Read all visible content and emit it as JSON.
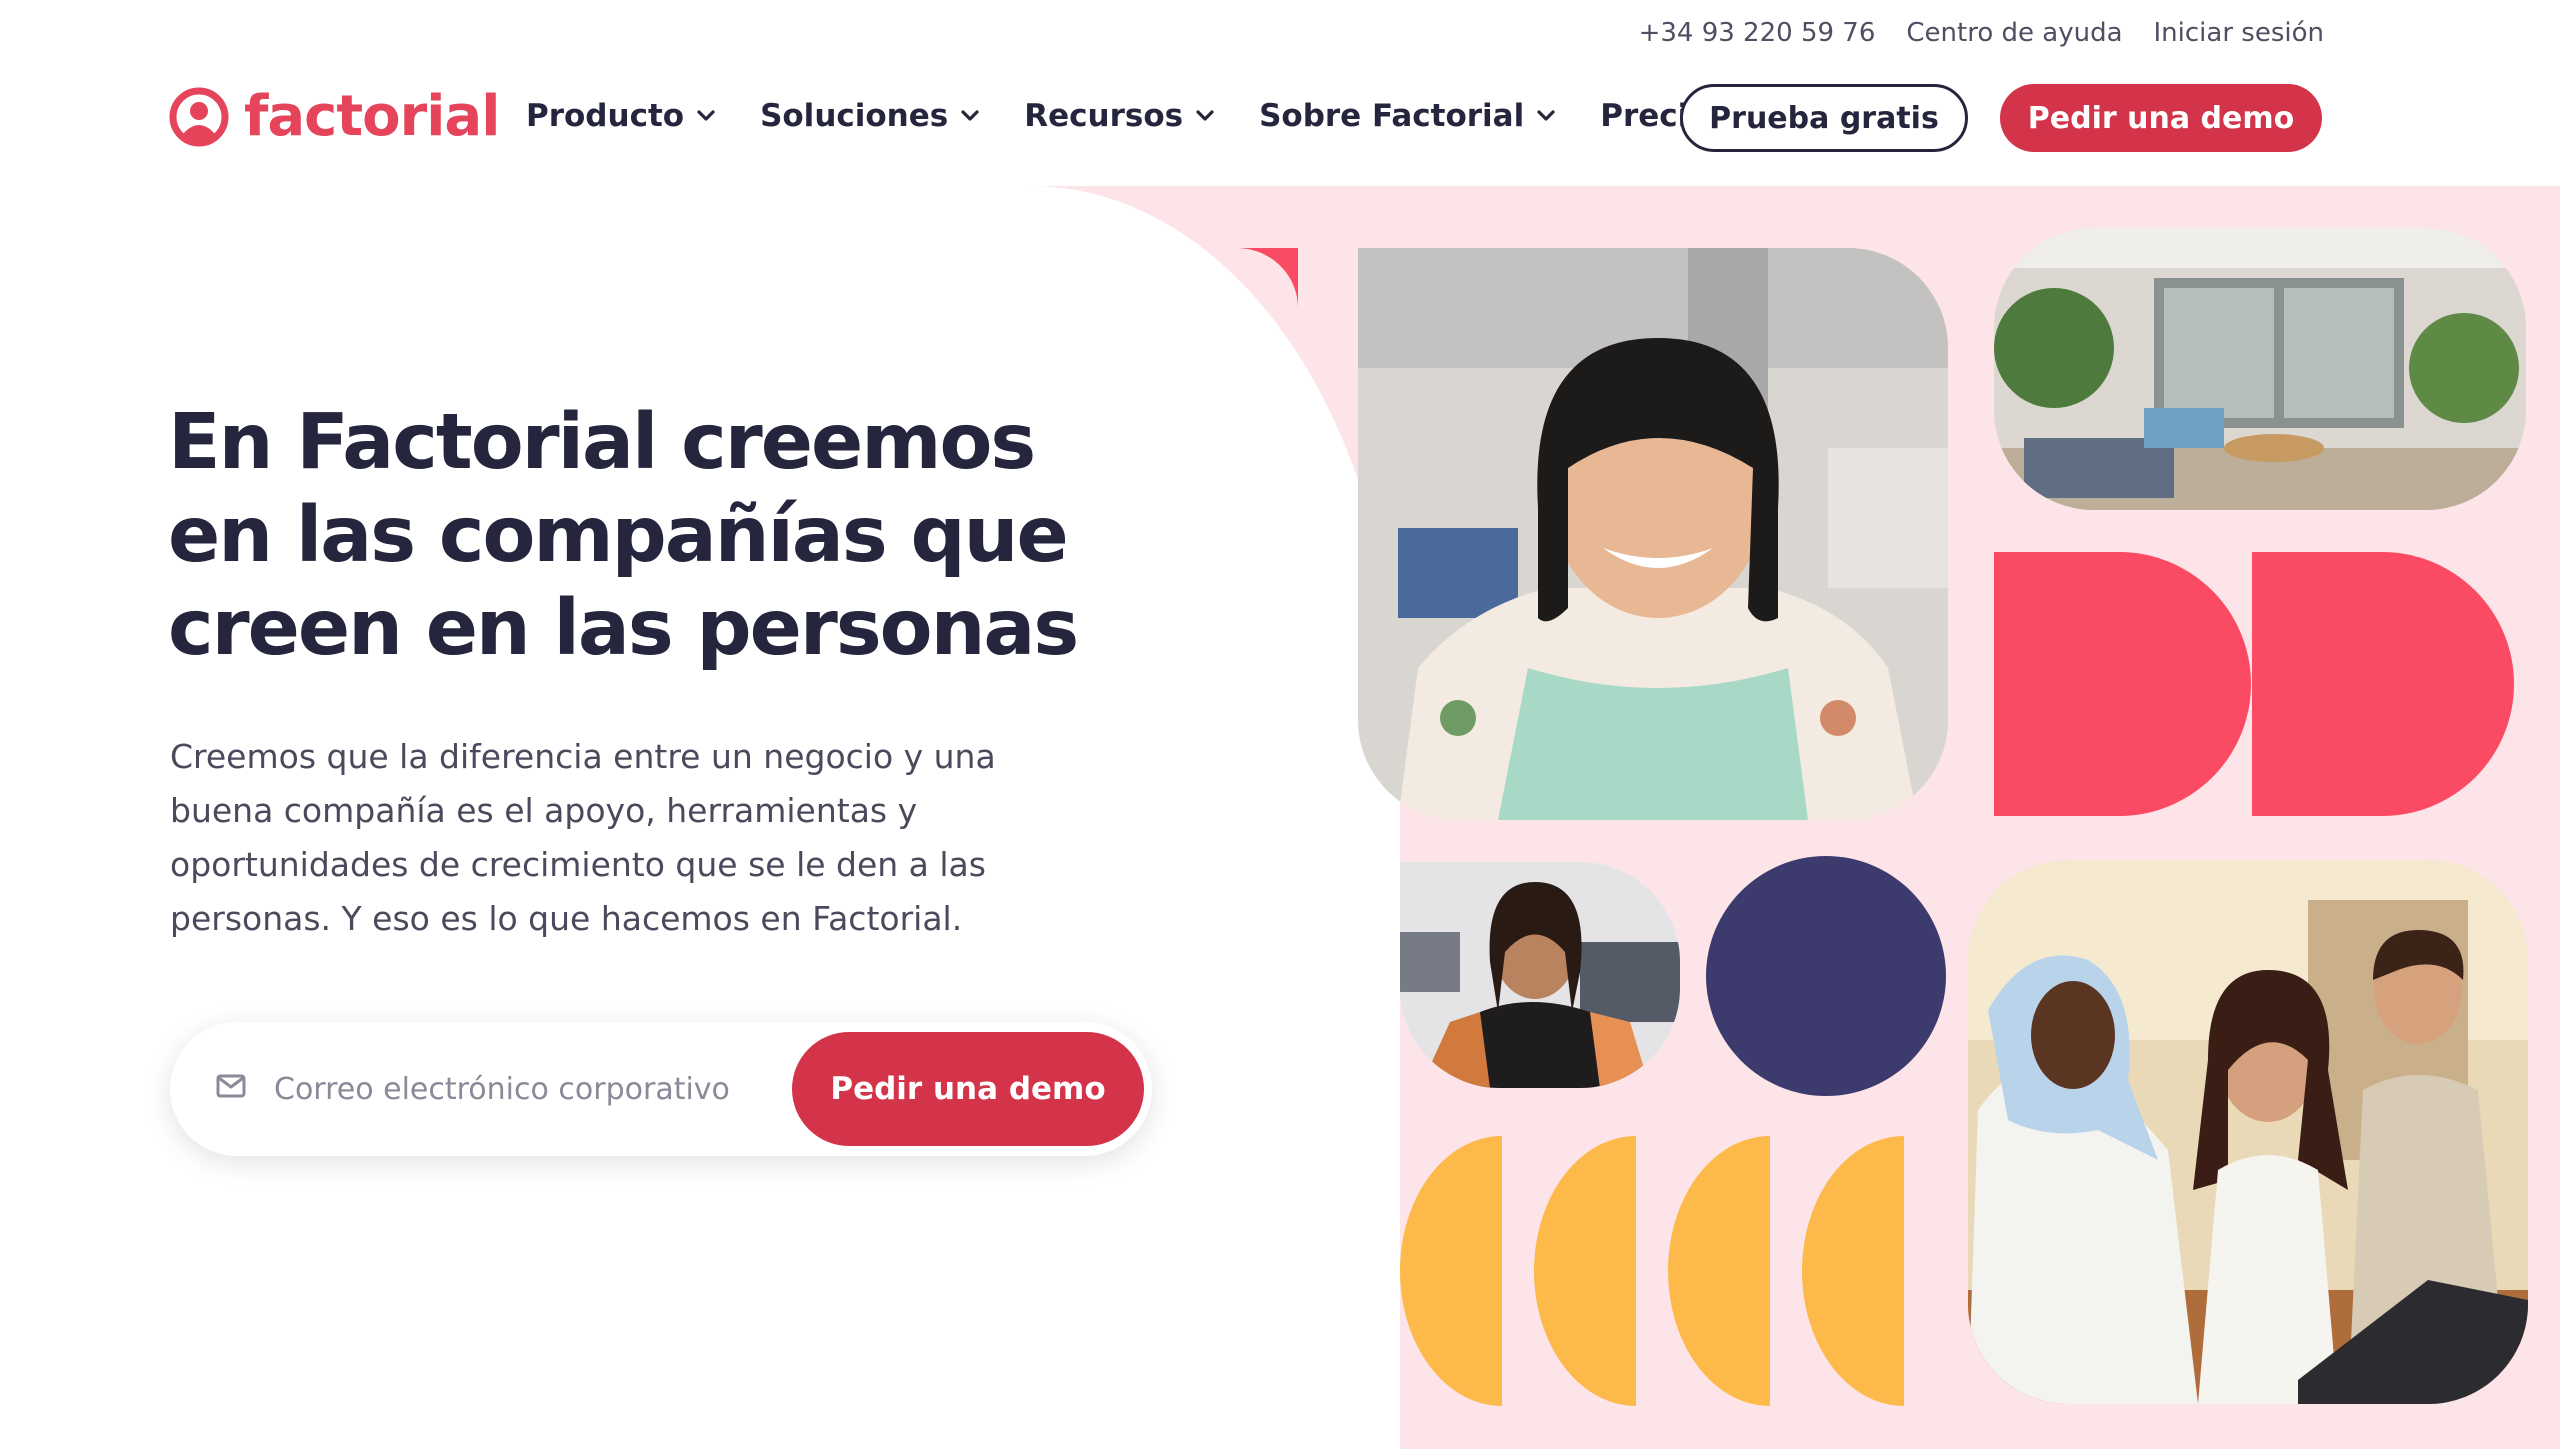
{
  "utility": {
    "phone": "+34 93 220 59 76",
    "help": "Centro de ayuda",
    "login": "Iniciar sesión"
  },
  "header": {
    "logo_text": "factorial",
    "nav": [
      {
        "label": "Producto",
        "has_dropdown": true
      },
      {
        "label": "Soluciones",
        "has_dropdown": true
      },
      {
        "label": "Recursos",
        "has_dropdown": true
      },
      {
        "label": "Sobre Factorial",
        "has_dropdown": true
      },
      {
        "label": "Precio",
        "has_dropdown": false
      }
    ],
    "trial_label": "Prueba gratis",
    "demo_label": "Pedir una demo"
  },
  "hero": {
    "title": "En Factorial creemos en las compañías que creen en las personas",
    "description": "Creemos que la diferencia entre un negocio y una buena compañía es el apoyo, herramientas y oportunidades de crecimiento que se le den a las personas. Y eso es lo que hacemos en Factorial.",
    "email_placeholder": "Correo electrónico corporativo",
    "email_value": "",
    "cta_label": "Pedir una demo"
  },
  "icons": {
    "mail": "mail-icon",
    "chevron": "chevron-down-icon",
    "logo": "factorial-logo-icon"
  },
  "colors": {
    "brand_red": "#e5445a",
    "button_red": "#d3344a",
    "dark_text": "#25253d",
    "pink_bg": "#fde4e9",
    "coral_shape": "#fb4a63",
    "navy_circle": "#3d3b6e",
    "yellow_shape": "#fdba4b"
  }
}
